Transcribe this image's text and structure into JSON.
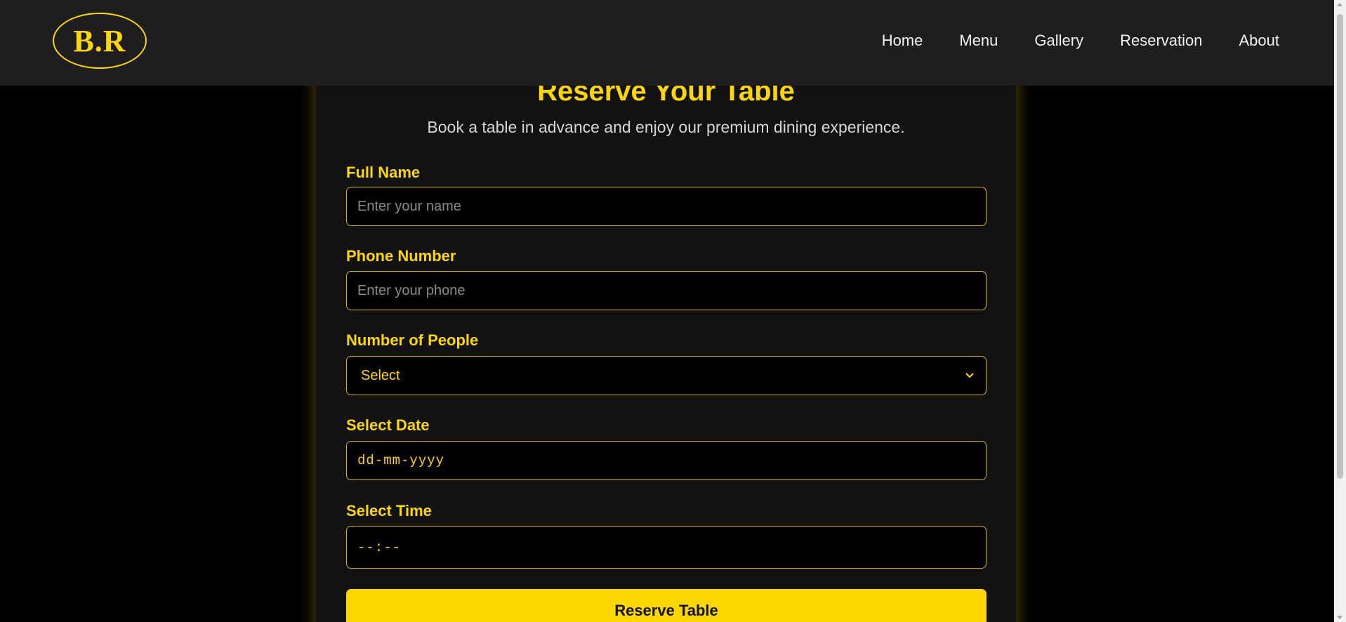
{
  "header": {
    "logo_text": "B.R",
    "nav": [
      {
        "label": "Home"
      },
      {
        "label": "Menu"
      },
      {
        "label": "Gallery"
      },
      {
        "label": "Reservation"
      },
      {
        "label": "About"
      }
    ]
  },
  "reservation": {
    "title": "Reserve Your Table",
    "subtitle": "Book a table in advance and enjoy our premium dining experience.",
    "fields": {
      "name": {
        "label": "Full Name",
        "placeholder": "Enter your name"
      },
      "phone": {
        "label": "Phone Number",
        "placeholder": "Enter your phone"
      },
      "people": {
        "label": "Number of People",
        "value": "Select"
      },
      "date": {
        "label": "Select Date",
        "value": "dd-mm-yyyy"
      },
      "time": {
        "label": "Select Time",
        "value": "--:--"
      }
    },
    "submit_label": "Reserve Table"
  },
  "colors": {
    "accent": "#FFD700",
    "header_bg": "#1e1e1e",
    "card_bg": "#121212",
    "page_bg": "#000000"
  },
  "icons": {
    "select_chevron": "chevron-down-icon"
  }
}
